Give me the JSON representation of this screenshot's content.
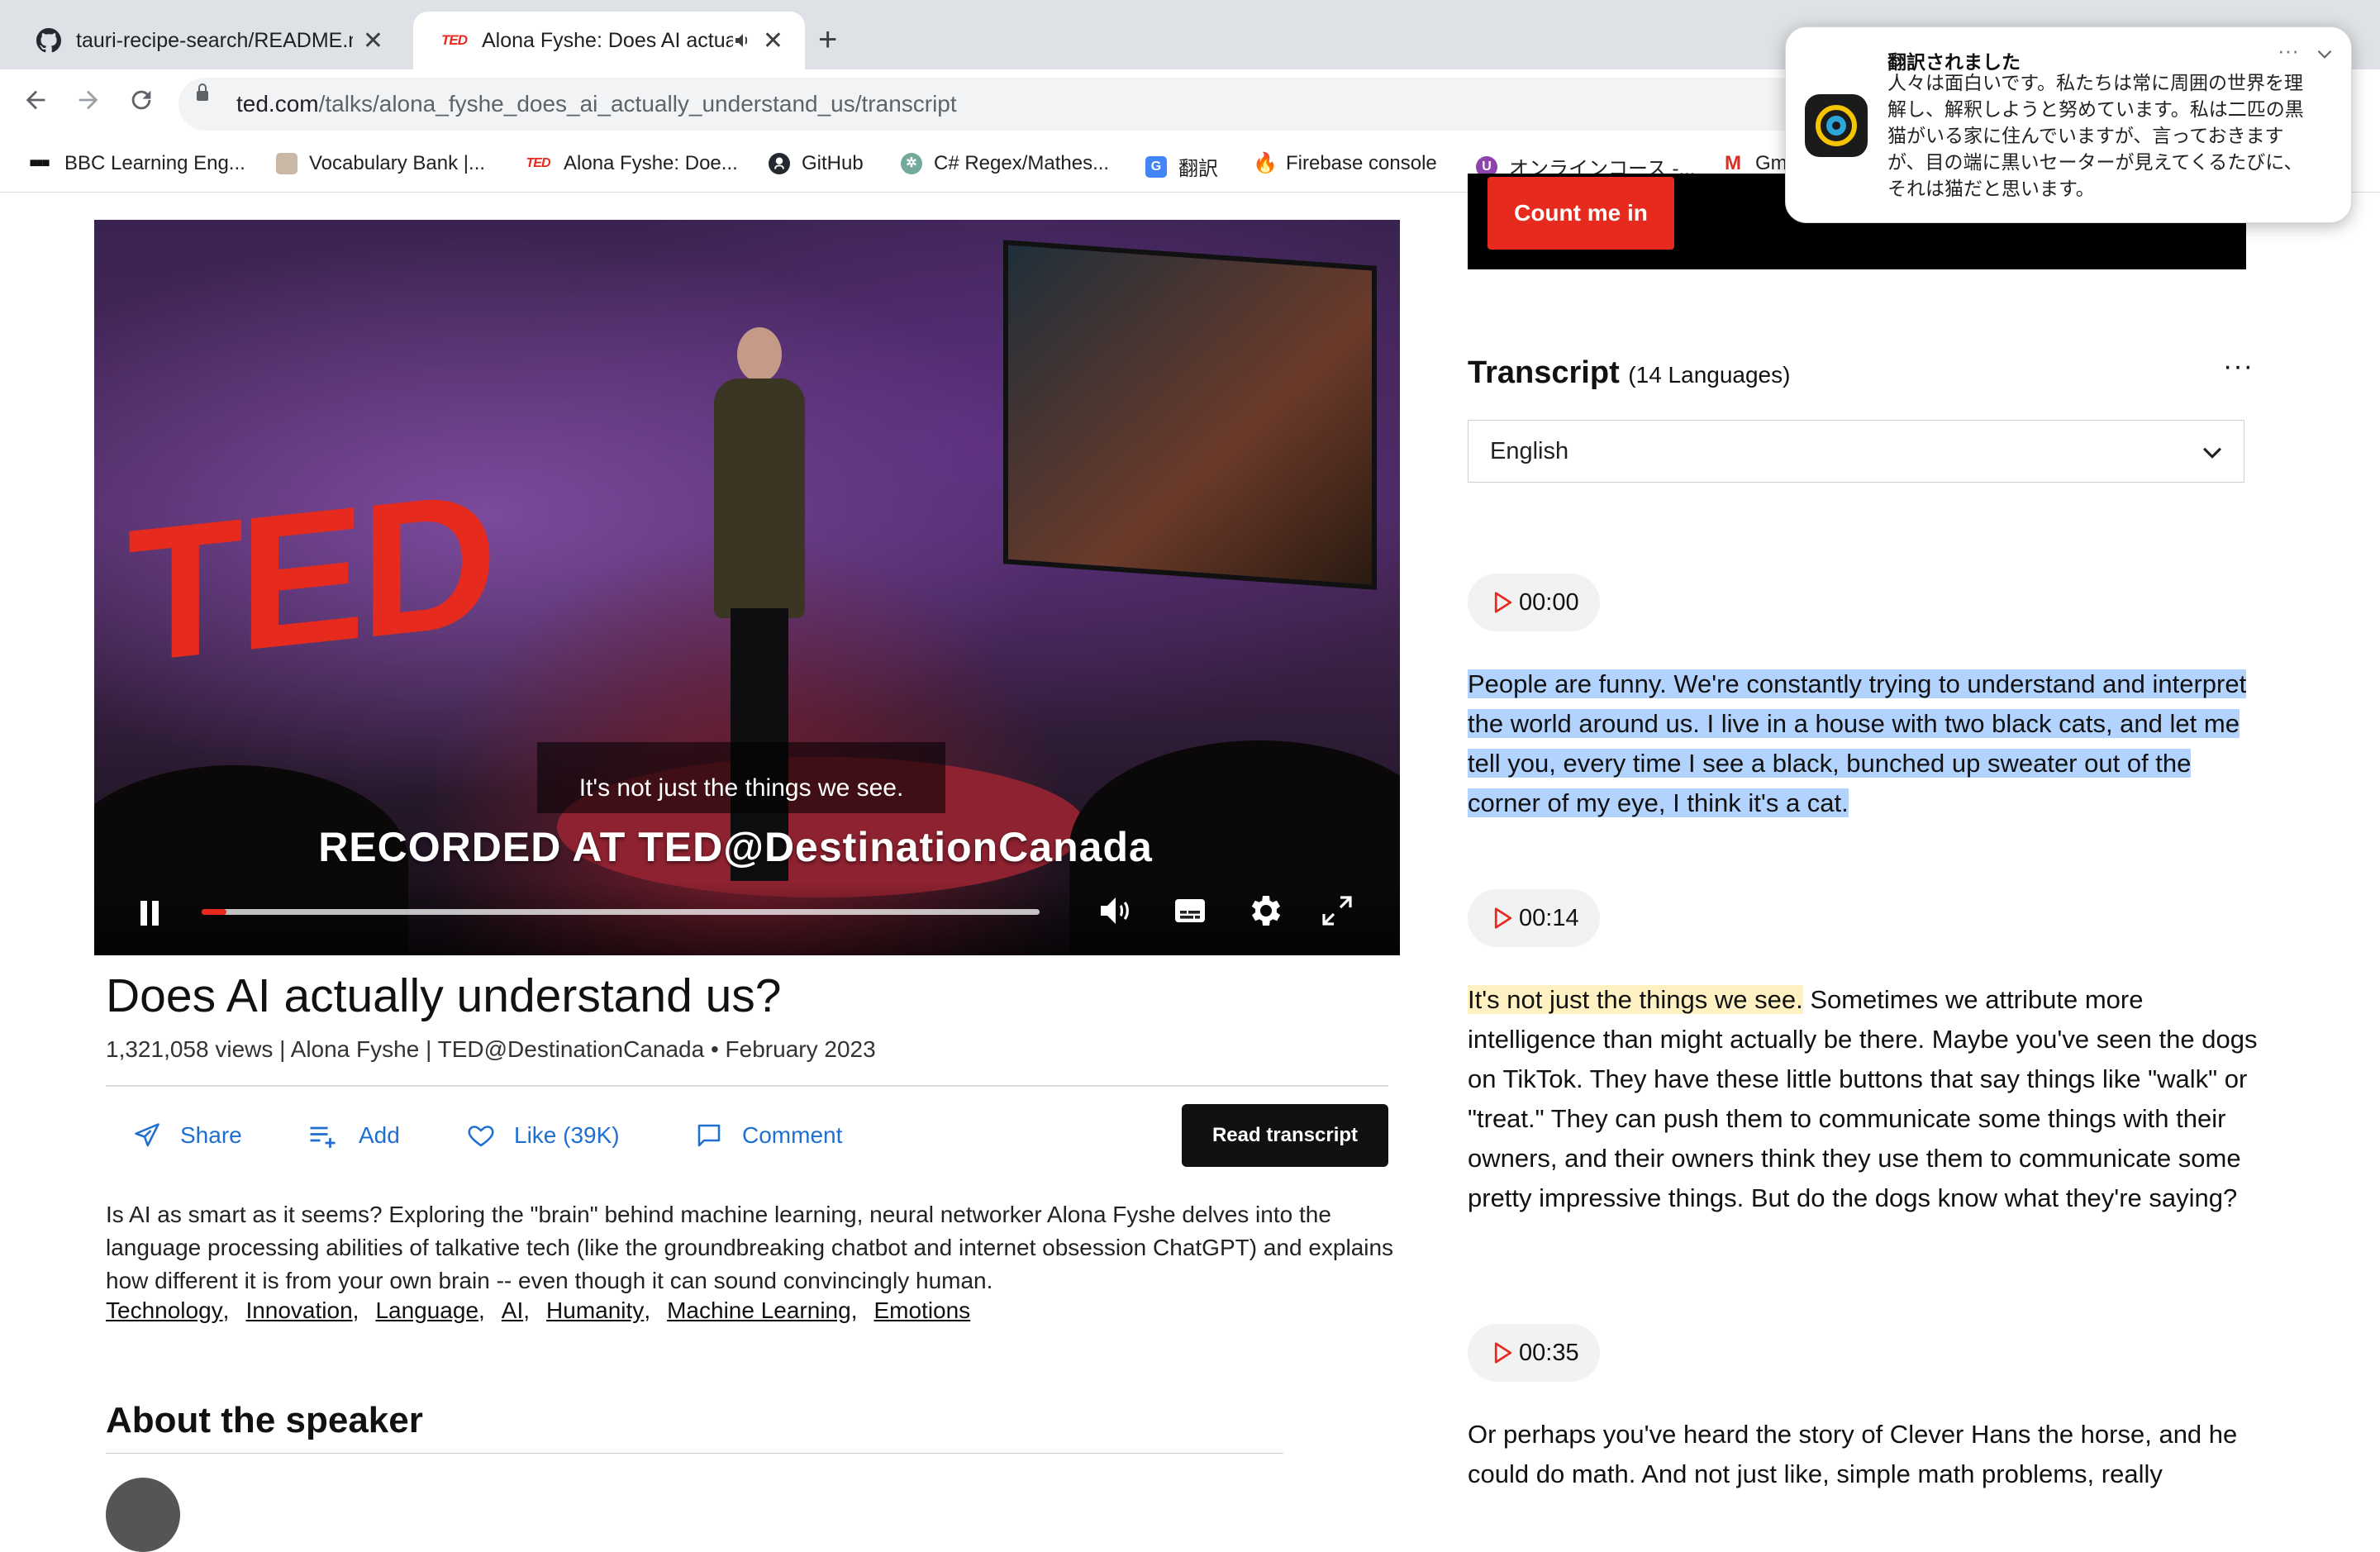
{
  "browser": {
    "tabs": [
      {
        "title": "tauri-recipe-search/README.md",
        "icon": "github-icon",
        "active": false
      },
      {
        "title": "Alona Fyshe: Does AI actually understand us?",
        "icon": "ted-icon",
        "active": true,
        "audio": true
      }
    ],
    "url_host": "ted.com",
    "url_path": "/talks/alona_fyshe_does_ai_actually_understand_us/transcript",
    "bookmarks": [
      {
        "label": "BBC Learning Eng...",
        "icon": "bbc-icon"
      },
      {
        "label": "Vocabulary Bank |...",
        "icon": "vocabulary-icon"
      },
      {
        "label": "Alona Fyshe: Doe...",
        "icon": "ted-icon"
      },
      {
        "label": "GitHub",
        "icon": "github-icon"
      },
      {
        "label": "C# Regex/Mathes...",
        "icon": "chatgpt-icon"
      },
      {
        "label": "翻訳",
        "icon": "translate-icon"
      },
      {
        "label": "Firebase console",
        "icon": "firebase-icon"
      },
      {
        "label": "オンラインコース -...",
        "icon": "course-icon"
      },
      {
        "label": "Gm",
        "icon": "gmail-icon"
      }
    ]
  },
  "video": {
    "caption": "It's not just the things we see.",
    "recorded_at": "RECORDED AT TED@DestinationCanada",
    "progress": 0.03,
    "playing": true
  },
  "talk": {
    "title": "Does AI actually understand us?",
    "meta": "1,321,058 views | Alona Fyshe | TED@DestinationCanada • February 2023",
    "actions": {
      "share": "Share",
      "add": "Add",
      "like": "Like (39K)",
      "comment": "Comment",
      "read_transcript": "Read transcript"
    },
    "description": "Is AI as smart as it seems? Exploring the \"brain\" behind machine learning, neural networker Alona Fyshe delves into the language processing abilities of talkative tech (like the groundbreaking chatbot and internet obsession ChatGPT) and explains how different it is from your own brain -- even though it can sound convincingly human.",
    "topics": [
      "Technology",
      "Innovation",
      "Language",
      "AI",
      "Humanity",
      "Machine Learning",
      "Emotions"
    ],
    "about_heading": "About the speaker"
  },
  "sidebar": {
    "cta_button": "Count me in",
    "transcript_title": "Transcript",
    "transcript_langs": "(14 Languages)",
    "language": "English",
    "segments": [
      {
        "time": "00:00",
        "text_highlight": "People are funny. We're constantly trying to understand and interpret the world around us. I live in a house with two black cats, and let me tell you, every time I see a black, bunched up sweater out of the corner of my eye, I think it's a cat.",
        "text_rest": ""
      },
      {
        "time": "00:14",
        "text_highlight": "It's not just the things we see.",
        "text_rest": " Sometimes we attribute more intelligence than might actually be there. Maybe you've seen the dogs on TikTok. They have these little buttons that say things like \"walk\" or \"treat.\" They can push them to communicate some things with their owners, and their owners think they use them to communicate some pretty impressive things. But do the dogs know what they're saying?"
      },
      {
        "time": "00:35",
        "text_highlight": "",
        "text_rest": "Or perhaps you've heard the story of Clever Hans the horse, and he could do math. And not just like, simple math problems, really"
      }
    ]
  },
  "notification": {
    "title": "翻訳されました",
    "body": "人々は面白いです。私たちは常に周囲の世界を理解し、解釈しようと努めています。私は二匹の黒猫がいる家に住んでいますが、言っておきますが、目の端に黒いセーターが見えてくるたびに、それは猫だと思います。"
  },
  "colors": {
    "ted_red": "#e62b1e",
    "link_blue": "#1f6fd1",
    "highlight_blue": "#b3d3ff",
    "highlight_yellow": "#fff1c2"
  }
}
